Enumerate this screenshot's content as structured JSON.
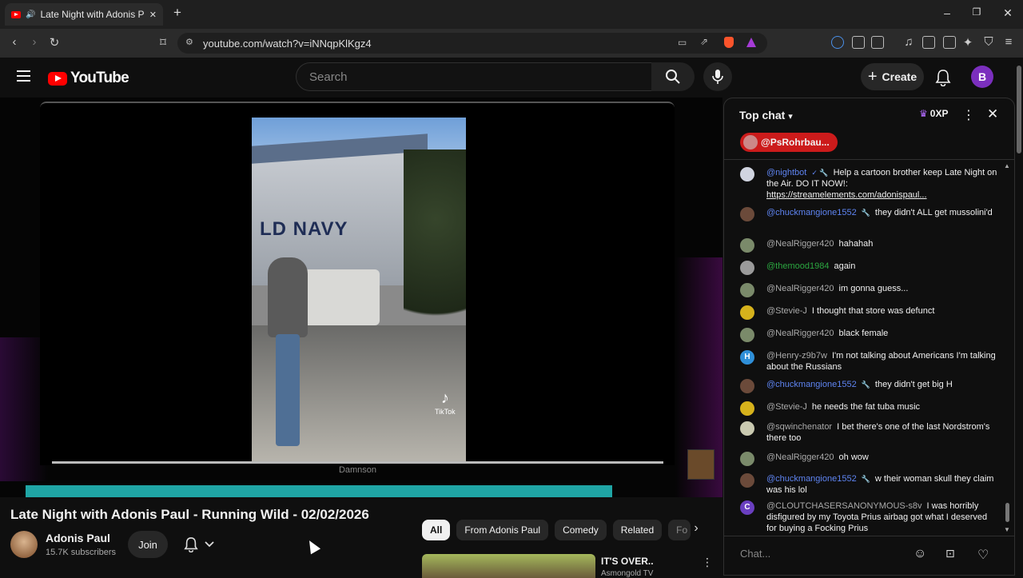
{
  "browser": {
    "tab_title": "Late Night with Adonis Paul -",
    "url": "youtube.com/watch?v=iNNqpKlKgz4",
    "new_tab": "+",
    "win_min": "–",
    "win_max": "❐",
    "win_close": "✕"
  },
  "header": {
    "logo_text": "YouTube",
    "search_placeholder": "Search",
    "create_label": "Create",
    "avatar_letter": "B"
  },
  "player": {
    "store_sign": "LD NAVY",
    "tiktok_label": "TikTok",
    "caption": "Damnson"
  },
  "video": {
    "title": "Late Night with Adonis Paul - Running Wild - 02/02/2026",
    "channel": "Adonis Paul",
    "subscribers": "15.7K subscribers",
    "join_label": "Join"
  },
  "chips": [
    "All",
    "From Adonis Paul",
    "Comedy",
    "Related",
    "Fo"
  ],
  "recommendation": {
    "title": "IT'S OVER..",
    "channel": "Asmongold TV"
  },
  "chat": {
    "header": "Top chat",
    "xp": "0XP",
    "pinned_user": "@PsRohrbau...",
    "input_placeholder": "Chat...",
    "messages": [
      {
        "user": "@nightbot",
        "badge": "✓ 🔧",
        "text": "Help a cartoon brother keep Late Night on the Air. DO IT NOW!: ",
        "link": "https://streamelements.com/adonispaul...",
        "color": "blue",
        "avatar": "#d0d4e0"
      },
      {
        "user": "@chuckmangione1552",
        "badge": "🔧",
        "text": "they didn't ALL get mussolini'd",
        "color": "blue",
        "avatar": "#6b4a3a"
      },
      {
        "user": "@NealRigger420",
        "text": "hahahah",
        "color": "gray",
        "avatar": "#7a8a6a"
      },
      {
        "user": "@themood1984",
        "text": "again",
        "color": "green",
        "avatar": "#9a9a9a"
      },
      {
        "user": "@NealRigger420",
        "text": "im gonna guess...",
        "color": "gray",
        "avatar": "#7a8a6a"
      },
      {
        "user": "@Stevie-J",
        "text": "I thought that store was defunct",
        "color": "gray",
        "avatar": "#d6b21c"
      },
      {
        "user": "@NealRigger420",
        "text": "black female",
        "color": "gray",
        "avatar": "#7a8a6a"
      },
      {
        "user": "@Henry-z9b7w",
        "text": "I'm not talking about Americans I'm talking about the Russians",
        "color": "gray",
        "avatar": "#2f8fd8",
        "letter": "H"
      },
      {
        "user": "@chuckmangione1552",
        "badge": "🔧",
        "text": "they didn't get big H",
        "color": "blue",
        "avatar": "#6b4a3a"
      },
      {
        "user": "@Stevie-J",
        "text": "he needs the fat tuba music",
        "color": "gray",
        "avatar": "#d6b21c"
      },
      {
        "user": "@sqwinchenator",
        "text": "I bet there's one of the last Nordstrom's there too",
        "color": "gray",
        "avatar": "#c9c9b0"
      },
      {
        "user": "@NealRigger420",
        "text": "oh wow",
        "color": "gray",
        "avatar": "#7a8a6a"
      },
      {
        "user": "@chuckmangione1552",
        "badge": "🔧",
        "text": "w their woman skull they claim was his lol",
        "color": "blue",
        "avatar": "#6b4a3a"
      },
      {
        "user": "@CLOUTCHASERSANONYMOUS-s8v",
        "text": "I was horribly disfigured by my Toyota Prius airbag got what I deserved for buying a Focking Prius",
        "color": "gray",
        "avatar": "#6a3fc0",
        "letter": "C"
      }
    ]
  },
  "colors": {
    "accent_red": "#ff0000",
    "pinned_red": "#cc1b1b",
    "ticker_teal": "#1fa5a5",
    "user_blue": "#5e84f1",
    "user_green": "#2ba640"
  }
}
